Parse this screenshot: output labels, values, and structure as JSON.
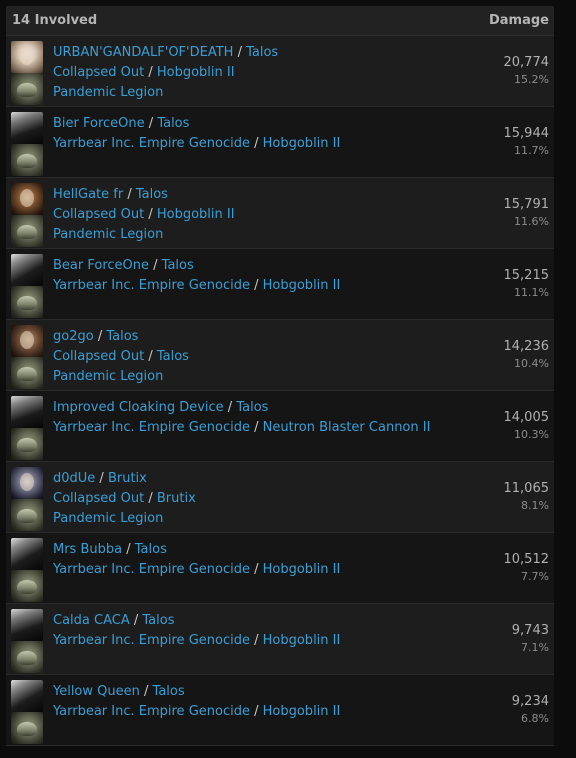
{
  "header": {
    "involved_label": "14 Involved",
    "damage_label": "Damage"
  },
  "rows": [
    {
      "pilot": "URBAN'GANDALF'OF'DEATH",
      "ship": "Talos",
      "corporation": "Collapsed Out",
      "weapon": "Hobgoblin II",
      "alliance": "Pandemic Legion",
      "damage": "20,774",
      "percent": "15.2%",
      "portrait_icon": "character-portrait-icon",
      "ship_icon": "talos-ship-icon"
    },
    {
      "pilot": "Bier ForceOne",
      "ship": "Talos",
      "corporation": "Yarrbear Inc. Empire Genocide",
      "weapon": "Hobgoblin II",
      "alliance": "",
      "damage": "15,944",
      "percent": "11.7%",
      "portrait_icon": "character-portrait-icon",
      "ship_icon": "talos-ship-icon"
    },
    {
      "pilot": "HellGate fr",
      "ship": "Talos",
      "corporation": "Collapsed Out",
      "weapon": "Hobgoblin II",
      "alliance": "Pandemic Legion",
      "damage": "15,791",
      "percent": "11.6%",
      "portrait_icon": "character-portrait-icon",
      "ship_icon": "talos-ship-icon"
    },
    {
      "pilot": "Bear ForceOne",
      "ship": "Talos",
      "corporation": "Yarrbear Inc. Empire Genocide",
      "weapon": "Hobgoblin II",
      "alliance": "",
      "damage": "15,215",
      "percent": "11.1%",
      "portrait_icon": "character-portrait-icon",
      "ship_icon": "talos-ship-icon"
    },
    {
      "pilot": "go2go",
      "ship": "Talos",
      "corporation": "Collapsed Out",
      "weapon": "Talos",
      "alliance": "Pandemic Legion",
      "damage": "14,236",
      "percent": "10.4%",
      "portrait_icon": "character-portrait-icon",
      "ship_icon": "talos-ship-icon"
    },
    {
      "pilot": "Improved Cloaking Device",
      "ship": "Talos",
      "corporation": "Yarrbear Inc. Empire Genocide",
      "weapon": "Neutron Blaster Cannon II",
      "alliance": "",
      "damage": "14,005",
      "percent": "10.3%",
      "portrait_icon": "character-portrait-icon",
      "ship_icon": "talos-ship-icon"
    },
    {
      "pilot": "d0dUe",
      "ship": "Brutix",
      "corporation": "Collapsed Out",
      "weapon": "Brutix",
      "alliance": "Pandemic Legion",
      "damage": "11,065",
      "percent": "8.1%",
      "portrait_icon": "character-portrait-icon",
      "ship_icon": "brutix-ship-icon"
    },
    {
      "pilot": "Mrs Bubba",
      "ship": "Talos",
      "corporation": "Yarrbear Inc. Empire Genocide",
      "weapon": "Hobgoblin II",
      "alliance": "",
      "damage": "10,512",
      "percent": "7.7%",
      "portrait_icon": "character-portrait-icon",
      "ship_icon": "talos-ship-icon"
    },
    {
      "pilot": "Calda CACA",
      "ship": "Talos",
      "corporation": "Yarrbear Inc. Empire Genocide",
      "weapon": "Hobgoblin II",
      "alliance": "",
      "damage": "9,743",
      "percent": "7.1%",
      "portrait_icon": "character-portrait-icon",
      "ship_icon": "talos-ship-icon"
    },
    {
      "pilot": "Yellow Queen",
      "ship": "Talos",
      "corporation": "Yarrbear Inc. Empire Genocide",
      "weapon": "Hobgoblin II",
      "alliance": "",
      "damage": "9,234",
      "percent": "6.8%",
      "portrait_icon": "character-portrait-icon",
      "ship_icon": "talos-ship-icon"
    }
  ],
  "colors": {
    "link": "#3a9fd6",
    "separator": "#c8c8c8",
    "damage_value": "#b0b0b0",
    "header_bg": "#222222"
  }
}
